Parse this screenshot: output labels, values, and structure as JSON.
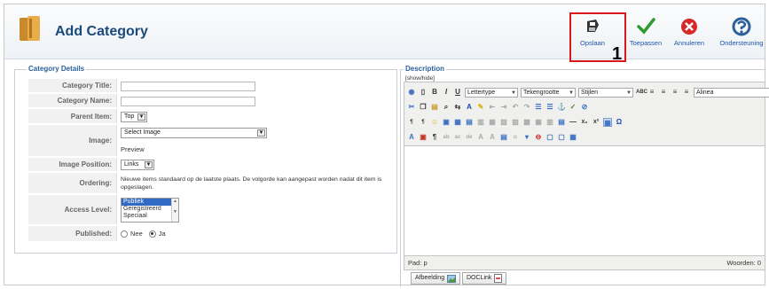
{
  "header": {
    "title": "Add Category",
    "buttons": [
      {
        "label": "Opslaan",
        "icon": "save-icon"
      },
      {
        "label": "Toepassen",
        "icon": "checkmark-icon"
      },
      {
        "label": "Annuleren",
        "icon": "cancel-icon"
      },
      {
        "label": "Ondersteuning",
        "icon": "help-icon"
      }
    ],
    "marker": "1",
    "colors": {
      "title": "#1a4a7a",
      "highlight": "#d6191b",
      "save": "#333333",
      "apply": "#2e9b2e",
      "cancel": "#d7282a",
      "help": "#2d5f9a"
    }
  },
  "details": {
    "legend": "Category Details",
    "title_label": "Category Title:",
    "name_label": "Category Name:",
    "parent_label": "Parent Item:",
    "parent_value": "Top",
    "image_label": "Image:",
    "image_value": "Select Image",
    "preview_label": "Preview",
    "image_position_label": "Image Position:",
    "image_position_value": "Links",
    "ordering_label": "Ordering:",
    "ordering_text": "Nieuwe items standaard op de laatste plaats. De volgorde kan aangepast worden nadat dit item is opgeslagen.",
    "access_label": "Access Level:",
    "access_options": [
      "Publiek",
      "Geregistreerd",
      "Speciaal"
    ],
    "published_label": "Published:",
    "published_no": "Nee",
    "published_yes": "Ja"
  },
  "description": {
    "legend": "Description",
    "toggle": "[show/hide]",
    "font_select": "Lettertype",
    "size_select": "Tekengrootte",
    "style_select": "Stijlen",
    "format_select": "Alinea",
    "path": "Pad: p",
    "word_count": "Woorden: 0",
    "image_button": "Afbeelding",
    "doclink_button": "DOCLink"
  }
}
